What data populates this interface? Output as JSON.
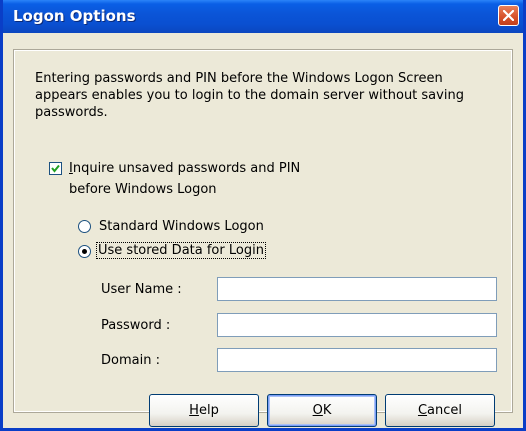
{
  "window": {
    "title": "Logon Options"
  },
  "description": "Entering passwords and PIN before the Windows Logon Screen appears enables you to login to the domain server without saving passwords.",
  "inquire_checkbox": {
    "checked": true,
    "label_line1_accesskey": "I",
    "label_line1_rest": "nquire unsaved passwords and PIN",
    "label_line2": "before Windows Logon"
  },
  "logon_mode": {
    "options": [
      {
        "label": "Standard Windows Logon",
        "selected": false
      },
      {
        "label": "Use stored Data for Login",
        "selected": true
      }
    ]
  },
  "fields": {
    "username": {
      "label": "User Name :",
      "value": ""
    },
    "password": {
      "label": "Password :",
      "value": ""
    },
    "domain": {
      "label": "Domain :",
      "value": ""
    }
  },
  "buttons": {
    "help": {
      "accesskey": "H",
      "rest": "elp"
    },
    "ok": {
      "accesskey": "O",
      "rest": "K"
    },
    "cancel": {
      "accesskey": "C",
      "rest": "ancel"
    }
  }
}
